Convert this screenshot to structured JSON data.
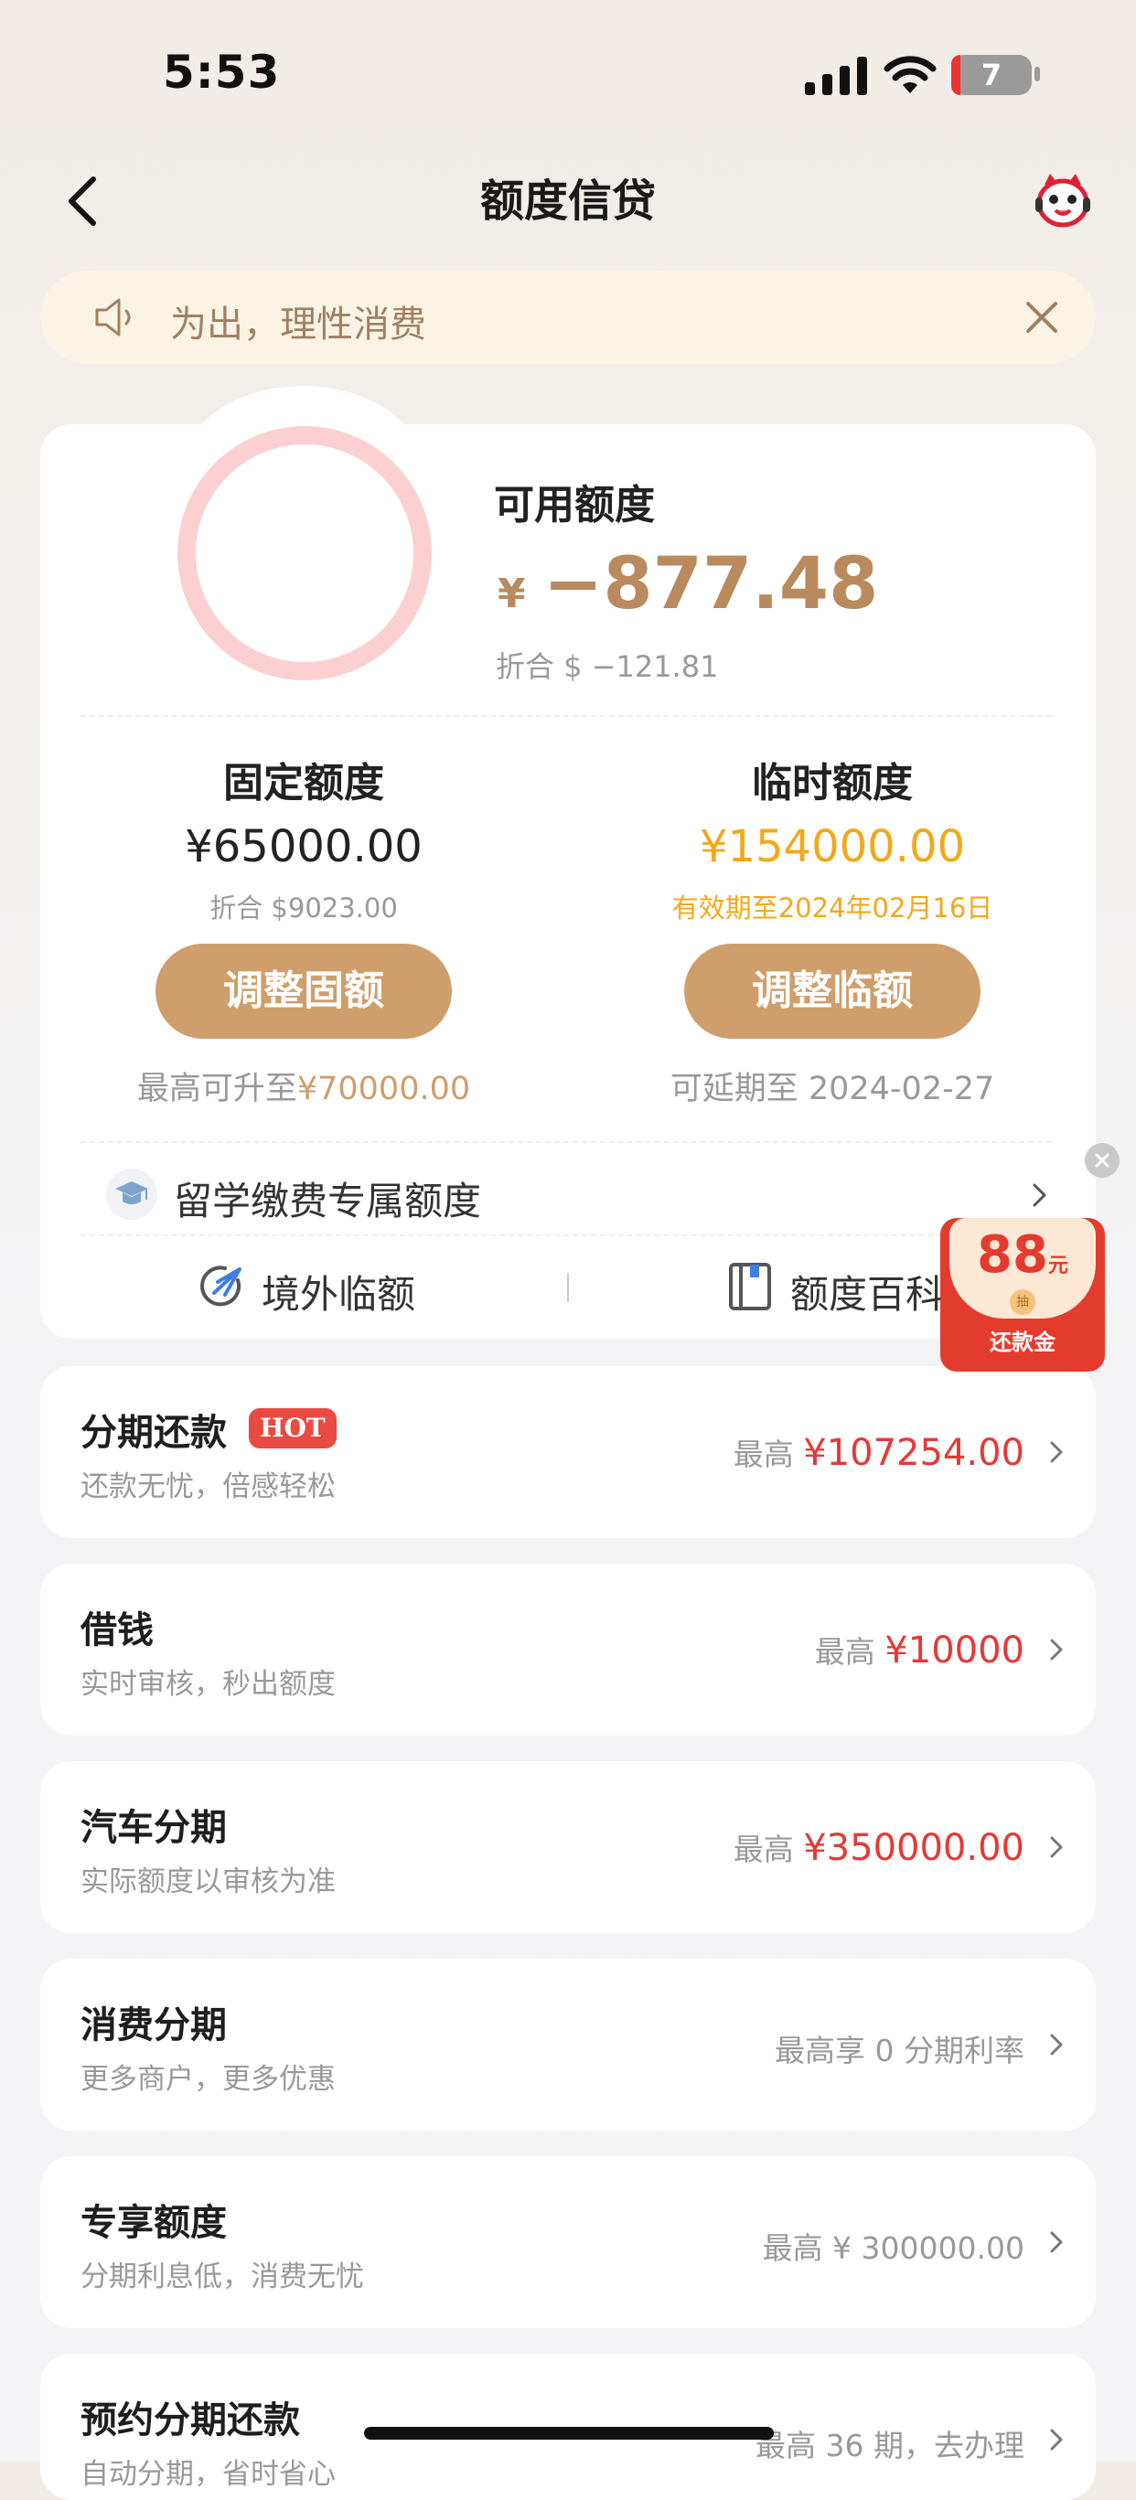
{
  "status_bar": {
    "time": "5:53",
    "battery": "7"
  },
  "nav": {
    "title": "额度信贷"
  },
  "notice": {
    "text": "为出，理性消费"
  },
  "credit": {
    "available_label": "可用额度",
    "currency": "¥",
    "available_value": "−877.48",
    "available_sub": "折合 $ −121.81"
  },
  "fixed": {
    "label": "固定额度",
    "value": "¥65000.00",
    "sub": "折合 $9023.00",
    "button": "调整固额",
    "max_prefix": "最高可升至",
    "max_value": "¥70000.00"
  },
  "temp": {
    "label": "临时额度",
    "value": "¥154000.00",
    "sub": "有效期至2024年02月16日",
    "button": "调整临额",
    "extend": "可延期至 2024-02-27"
  },
  "study": {
    "text": "留学缴费专属额度"
  },
  "links": {
    "overseas": "境外临额",
    "wiki": "额度百科"
  },
  "packet": {
    "amount": "88",
    "unit": "元",
    "coin": "抽",
    "label": "还款金"
  },
  "hot_badge": "HOT",
  "rows": [
    {
      "title": "分期还款",
      "sub": "还款无忧，倍感轻松",
      "right_prefix": "最高",
      "right_amount": "¥107254.00"
    },
    {
      "title": "借钱",
      "sub": "实时审核，秒出额度",
      "right_prefix": "最高",
      "right_amount": "¥10000"
    },
    {
      "title": "汽车分期",
      "sub": "实际额度以审核为准",
      "right_prefix": "最高",
      "right_amount": "¥350000.00"
    },
    {
      "title": "消费分期",
      "sub": "更多商户，更多优惠",
      "right_text": "最高享 0 分期利率"
    },
    {
      "title": "专享额度",
      "sub": "分期利息低，消费无忧",
      "right_text": "最高 ¥ 300000.00"
    },
    {
      "title": "预约分期还款",
      "sub": "自动分期，省时省心",
      "right_text": "最高 36 期，去办理"
    }
  ]
}
